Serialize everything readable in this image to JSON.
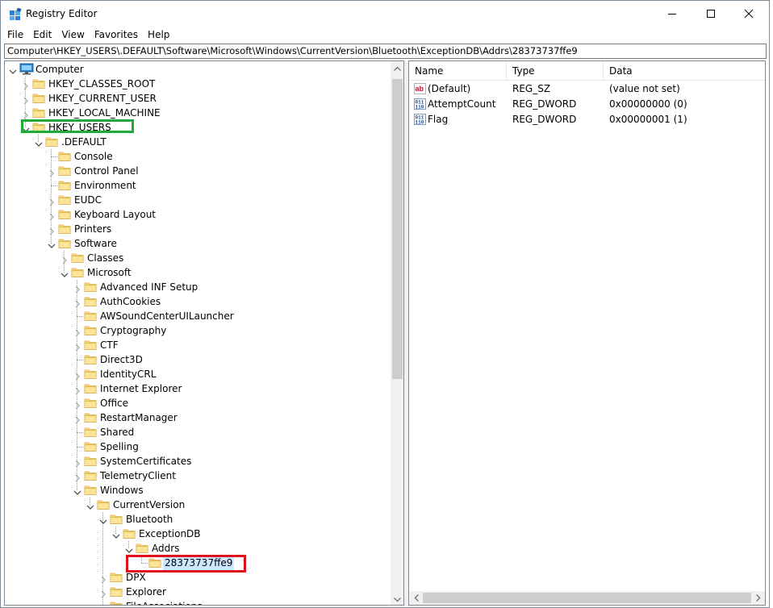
{
  "window": {
    "title": "Registry Editor",
    "icon": "registry-editor-icon",
    "controls": [
      "minimize-icon",
      "maximize-icon",
      "close-icon"
    ]
  },
  "menu": [
    "File",
    "Edit",
    "View",
    "Favorites",
    "Help"
  ],
  "address": "Computer\\HKEY_USERS\\.DEFAULT\\Software\\Microsoft\\Windows\\CurrentVersion\\Bluetooth\\ExceptionDB\\Addrs\\28373737ffe9",
  "tree": [
    {
      "label": "Computer",
      "depth": 0,
      "expander": "expanded",
      "icon": "computer-icon"
    },
    {
      "label": "HKEY_CLASSES_ROOT",
      "depth": 1,
      "expander": "collapsed",
      "icon": "folder-icon"
    },
    {
      "label": "HKEY_CURRENT_USER",
      "depth": 1,
      "expander": "collapsed",
      "icon": "folder-icon"
    },
    {
      "label": "HKEY_LOCAL_MACHINE",
      "depth": 1,
      "expander": "collapsed",
      "icon": "folder-icon"
    },
    {
      "label": "HKEY_USERS",
      "depth": 1,
      "expander": "expanded",
      "icon": "folder-icon"
    },
    {
      "label": ".DEFAULT",
      "depth": 2,
      "expander": "expanded",
      "icon": "folder-icon"
    },
    {
      "label": "Console",
      "depth": 3,
      "expander": "none",
      "icon": "folder-icon"
    },
    {
      "label": "Control Panel",
      "depth": 3,
      "expander": "collapsed",
      "icon": "folder-icon"
    },
    {
      "label": "Environment",
      "depth": 3,
      "expander": "none",
      "icon": "folder-icon"
    },
    {
      "label": "EUDC",
      "depth": 3,
      "expander": "collapsed",
      "icon": "folder-icon"
    },
    {
      "label": "Keyboard Layout",
      "depth": 3,
      "expander": "collapsed",
      "icon": "folder-icon"
    },
    {
      "label": "Printers",
      "depth": 3,
      "expander": "collapsed",
      "icon": "folder-icon"
    },
    {
      "label": "Software",
      "depth": 3,
      "expander": "expanded",
      "icon": "folder-icon"
    },
    {
      "label": "Classes",
      "depth": 4,
      "expander": "collapsed",
      "icon": "folder-icon"
    },
    {
      "label": "Microsoft",
      "depth": 4,
      "expander": "expanded",
      "icon": "folder-icon"
    },
    {
      "label": "Advanced INF Setup",
      "depth": 5,
      "expander": "collapsed",
      "icon": "folder-icon"
    },
    {
      "label": "AuthCookies",
      "depth": 5,
      "expander": "collapsed",
      "icon": "folder-icon"
    },
    {
      "label": "AWSoundCenterUILauncher",
      "depth": 5,
      "expander": "none",
      "icon": "folder-icon"
    },
    {
      "label": "Cryptography",
      "depth": 5,
      "expander": "collapsed",
      "icon": "folder-icon"
    },
    {
      "label": "CTF",
      "depth": 5,
      "expander": "collapsed",
      "icon": "folder-icon"
    },
    {
      "label": "Direct3D",
      "depth": 5,
      "expander": "none",
      "icon": "folder-icon"
    },
    {
      "label": "IdentityCRL",
      "depth": 5,
      "expander": "collapsed",
      "icon": "folder-icon"
    },
    {
      "label": "Internet Explorer",
      "depth": 5,
      "expander": "collapsed",
      "icon": "folder-icon"
    },
    {
      "label": "Office",
      "depth": 5,
      "expander": "collapsed",
      "icon": "folder-icon"
    },
    {
      "label": "RestartManager",
      "depth": 5,
      "expander": "collapsed",
      "icon": "folder-icon"
    },
    {
      "label": "Shared",
      "depth": 5,
      "expander": "none",
      "icon": "folder-icon"
    },
    {
      "label": "Spelling",
      "depth": 5,
      "expander": "none",
      "icon": "folder-icon"
    },
    {
      "label": "SystemCertificates",
      "depth": 5,
      "expander": "collapsed",
      "icon": "folder-icon"
    },
    {
      "label": "TelemetryClient",
      "depth": 5,
      "expander": "collapsed",
      "icon": "folder-icon"
    },
    {
      "label": "Windows",
      "depth": 5,
      "expander": "expanded",
      "icon": "folder-icon"
    },
    {
      "label": "CurrentVersion",
      "depth": 6,
      "expander": "expanded",
      "icon": "folder-icon"
    },
    {
      "label": "Bluetooth",
      "depth": 7,
      "expander": "expanded",
      "icon": "folder-icon"
    },
    {
      "label": "ExceptionDB",
      "depth": 8,
      "expander": "expanded",
      "icon": "folder-icon"
    },
    {
      "label": "Addrs",
      "depth": 9,
      "expander": "expanded",
      "icon": "folder-icon"
    },
    {
      "label": "28373737ffe9",
      "depth": 10,
      "expander": "none",
      "icon": "folder-icon",
      "selected": true
    },
    {
      "label": "DPX",
      "depth": 7,
      "expander": "collapsed",
      "icon": "folder-icon"
    },
    {
      "label": "Explorer",
      "depth": 7,
      "expander": "collapsed",
      "icon": "folder-icon"
    },
    {
      "label": "FileAssociations",
      "depth": 7,
      "expander": "collapsed",
      "icon": "folder-icon"
    }
  ],
  "list": {
    "columns": [
      "Name",
      "Type",
      "Data"
    ],
    "rows": [
      {
        "name": "(Default)",
        "type": "REG_SZ",
        "data": "(value not set)",
        "icon": "string-value-icon"
      },
      {
        "name": "AttemptCount",
        "type": "REG_DWORD",
        "data": "0x00000000 (0)",
        "icon": "binary-value-icon"
      },
      {
        "name": "Flag",
        "type": "REG_DWORD",
        "data": "0x00000001 (1)",
        "icon": "binary-value-icon"
      }
    ]
  },
  "colors": {
    "selection": "#cce8ff",
    "folder": "#f8d775",
    "highlight_green": "#1faa3a",
    "highlight_red": "#e0111b"
  }
}
